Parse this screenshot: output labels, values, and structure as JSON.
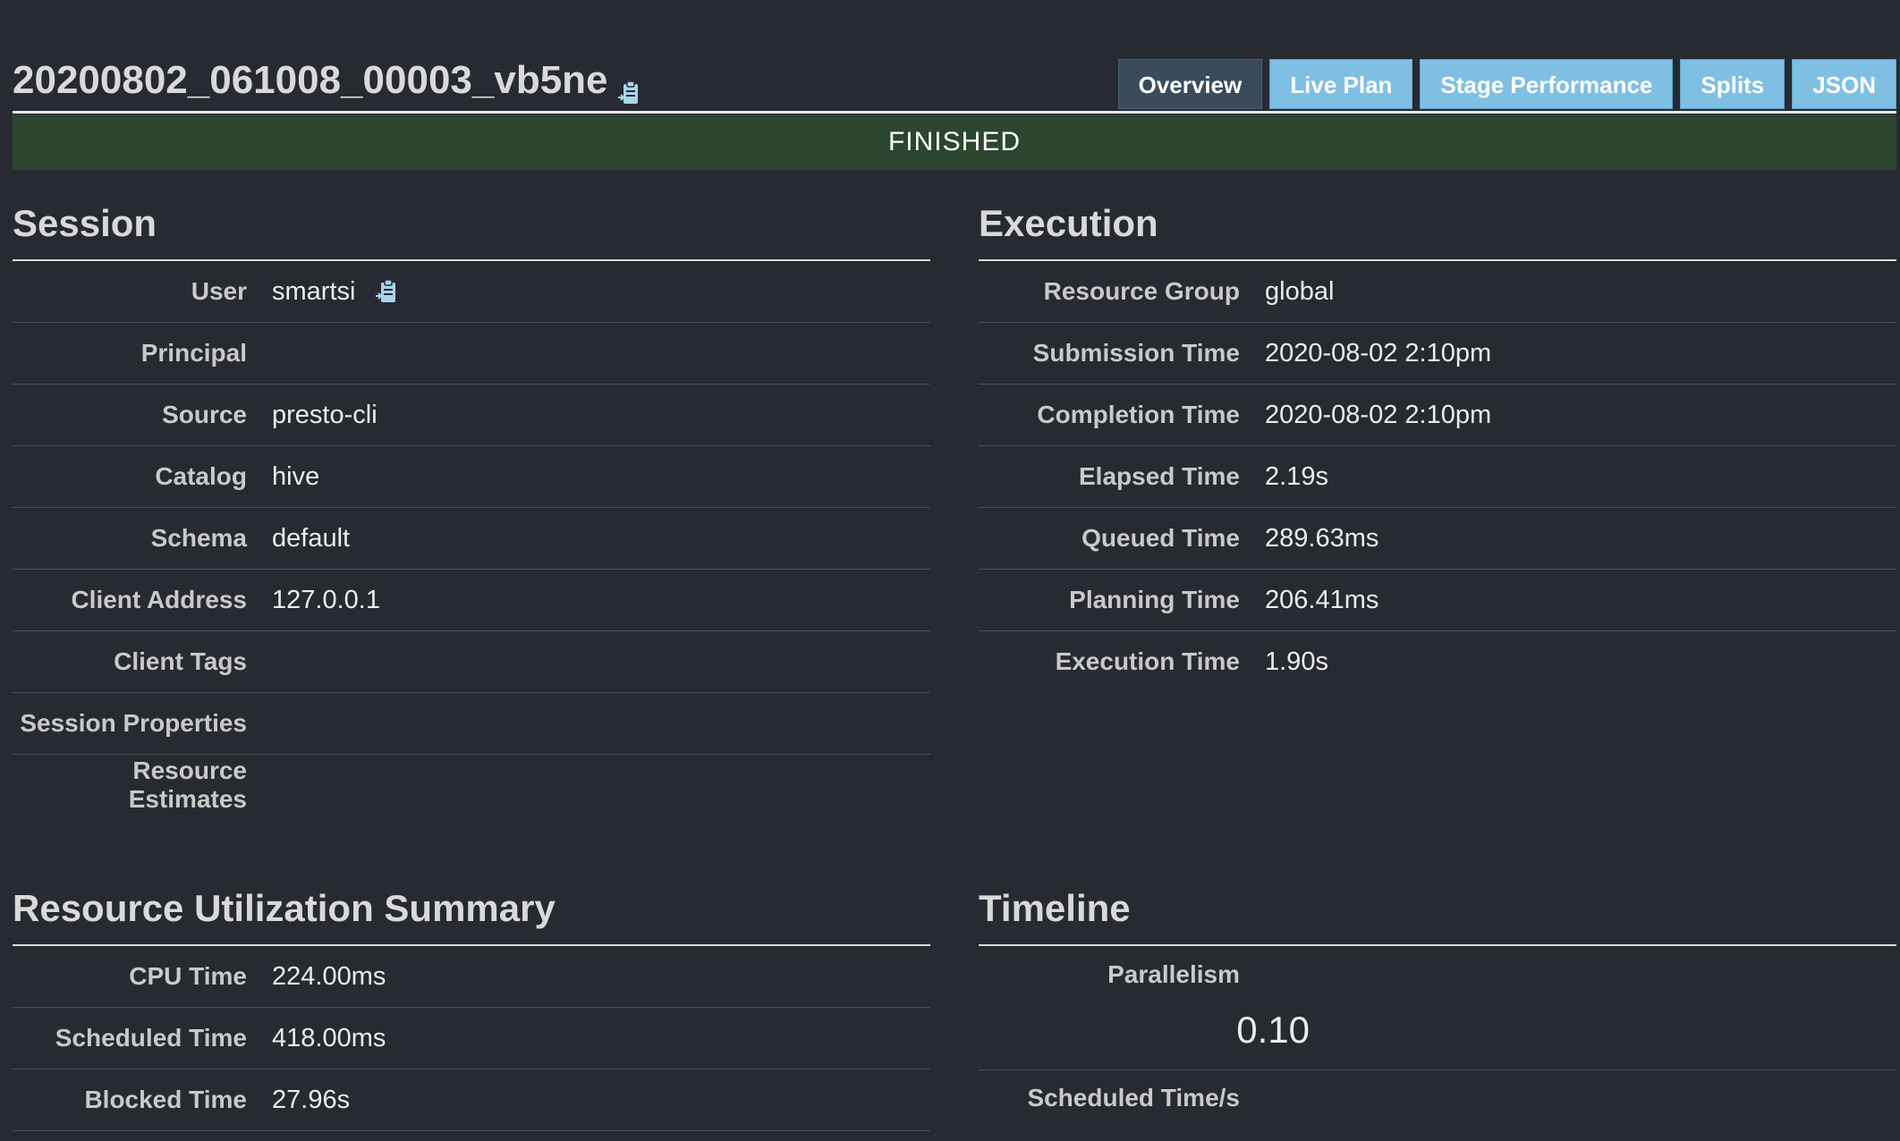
{
  "header": {
    "query_id": "20200802_061008_00003_vb5ne",
    "copy_icon": "clipboard-icon",
    "tabs": [
      {
        "label": "Overview",
        "active": true
      },
      {
        "label": "Live Plan",
        "active": false
      },
      {
        "label": "Stage Performance",
        "active": false
      },
      {
        "label": "Splits",
        "active": false
      },
      {
        "label": "JSON",
        "active": false
      }
    ]
  },
  "state": {
    "label": "FINISHED",
    "color": "#2c4630"
  },
  "session": {
    "title": "Session",
    "rows": [
      {
        "key": "User",
        "value": "smartsi"
      },
      {
        "key": "Principal",
        "value": ""
      },
      {
        "key": "Source",
        "value": "presto-cli"
      },
      {
        "key": "Catalog",
        "value": "hive"
      },
      {
        "key": "Schema",
        "value": "default"
      },
      {
        "key": "Client Address",
        "value": "127.0.0.1"
      },
      {
        "key": "Client Tags",
        "value": ""
      },
      {
        "key": "Session Properties",
        "value": ""
      },
      {
        "key": "Resource Estimates",
        "value": ""
      }
    ]
  },
  "execution": {
    "title": "Execution",
    "rows": [
      {
        "key": "Resource Group",
        "value": "global"
      },
      {
        "key": "Submission Time",
        "value": "2020-08-02 2:10pm"
      },
      {
        "key": "Completion Time",
        "value": "2020-08-02 2:10pm"
      },
      {
        "key": "Elapsed Time",
        "value": "2.19s"
      },
      {
        "key": "Queued Time",
        "value": "289.63ms"
      },
      {
        "key": "Planning Time",
        "value": "206.41ms"
      },
      {
        "key": "Execution Time",
        "value": "1.90s"
      }
    ]
  },
  "resource_summary": {
    "title": "Resource Utilization Summary",
    "rows": [
      {
        "key": "CPU Time",
        "value": "224.00ms"
      },
      {
        "key": "Scheduled Time",
        "value": "418.00ms"
      },
      {
        "key": "Blocked Time",
        "value": "27.96s"
      }
    ]
  },
  "timeline": {
    "title": "Timeline",
    "parallelism_label": "Parallelism",
    "parallelism_value": "0.10",
    "scheduled_label": "Scheduled Time/s"
  }
}
